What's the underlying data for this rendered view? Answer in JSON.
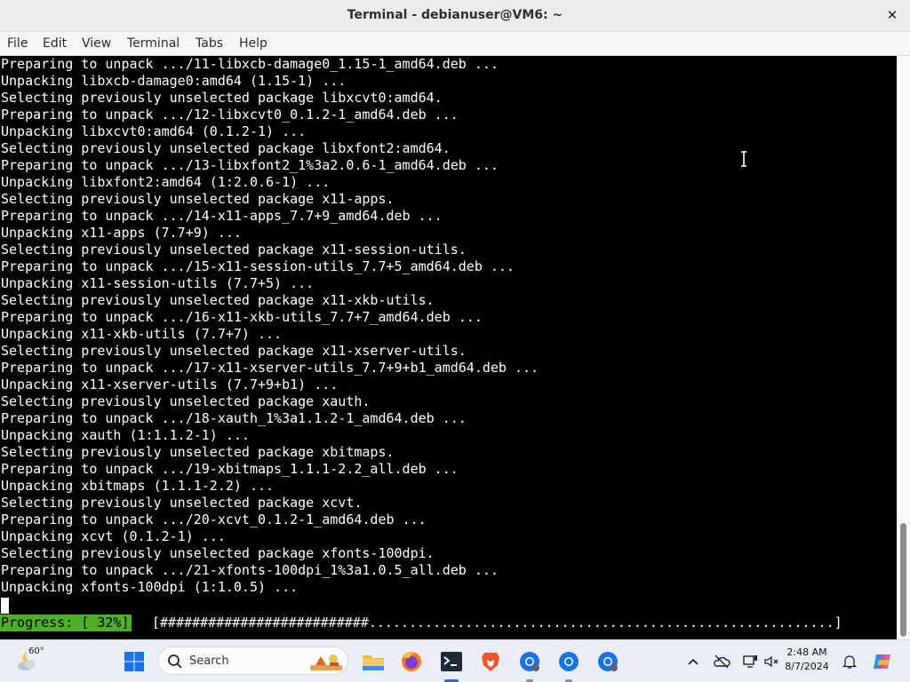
{
  "window": {
    "title": "Terminal - debianuser@VM6: ~",
    "close_glyph": "✕"
  },
  "menu": [
    "File",
    "Edit",
    "View",
    "Terminal",
    "Tabs",
    "Help"
  ],
  "terminal": {
    "lines": [
      "Preparing to unpack .../11-libxcb-damage0_1.15-1_amd64.deb ...",
      "Unpacking libxcb-damage0:amd64 (1.15-1) ...",
      "Selecting previously unselected package libxcvt0:amd64.",
      "Preparing to unpack .../12-libxcvt0_0.1.2-1_amd64.deb ...",
      "Unpacking libxcvt0:amd64 (0.1.2-1) ...",
      "Selecting previously unselected package libxfont2:amd64.",
      "Preparing to unpack .../13-libxfont2_1%3a2.0.6-1_amd64.deb ...",
      "Unpacking libxfont2:amd64 (1:2.0.6-1) ...",
      "Selecting previously unselected package x11-apps.",
      "Preparing to unpack .../14-x11-apps_7.7+9_amd64.deb ...",
      "Unpacking x11-apps (7.7+9) ...",
      "Selecting previously unselected package x11-session-utils.",
      "Preparing to unpack .../15-x11-session-utils_7.7+5_amd64.deb ...",
      "Unpacking x11-session-utils (7.7+5) ...",
      "Selecting previously unselected package x11-xkb-utils.",
      "Preparing to unpack .../16-x11-xkb-utils_7.7+7_amd64.deb ...",
      "Unpacking x11-xkb-utils (7.7+7) ...",
      "Selecting previously unselected package x11-xserver-utils.",
      "Preparing to unpack .../17-x11-xserver-utils_7.7+9+b1_amd64.deb ...",
      "Unpacking x11-xserver-utils (7.7+9+b1) ...",
      "Selecting previously unselected package xauth.",
      "Preparing to unpack .../18-xauth_1%3a1.1.2-1_amd64.deb ...",
      "Unpacking xauth (1:1.1.2-1) ...",
      "Selecting previously unselected package xbitmaps.",
      "Preparing to unpack .../19-xbitmaps_1.1.1-2.2_all.deb ...",
      "Unpacking xbitmaps (1.1.1-2.2) ...",
      "Selecting previously unselected package xcvt.",
      "Preparing to unpack .../20-xcvt_0.1.2-1_amd64.deb ...",
      "Unpacking xcvt (0.1.2-1) ...",
      "Selecting previously unselected package xfonts-100dpi.",
      "Preparing to unpack .../21-xfonts-100dpi_1%3a1.0.5_all.deb ...",
      "Unpacking xfonts-100dpi (1:1.0.5) ..."
    ],
    "progress_label": "Progress: [ 32%]",
    "progress_bar": "[##########################..........................................................]",
    "progress_percent": 32
  },
  "taskbar": {
    "weather_temp": "60°",
    "search_placeholder": "Search",
    "clock_time": "2:48 AM",
    "clock_date": "8/7/2024"
  },
  "colors": {
    "terminal_bg": "#000000",
    "terminal_fg": "#ffffff",
    "progress_green": "#4caf27",
    "taskbar_bg": "#e9eef4"
  }
}
